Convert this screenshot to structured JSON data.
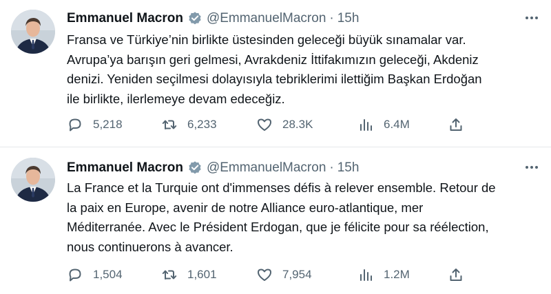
{
  "tweets": [
    {
      "author": {
        "name": "Emmanuel Macron",
        "handle": "@EmmanuelMacron",
        "verified": true
      },
      "separator": "·",
      "time": "15h",
      "text": "Fransa ve Türkiye’nin birlikte üstesinden geleceği büyük sınamalar var.\nAvrupa’ya barışın geri gelmesi, Avrakdeniz İttifakımızın geleceği, Akdeniz\ndenizi. Yeniden seçilmesi dolayısıyla tebriklerimi ilettiğim Başkan Erdoğan\nile birlikte, ilerlemeye devam edeceğiz.",
      "stats": {
        "replies": "5,218",
        "retweets": "6,233",
        "likes": "28.3K",
        "views": "6.4M"
      }
    },
    {
      "author": {
        "name": "Emmanuel Macron",
        "handle": "@EmmanuelMacron",
        "verified": true
      },
      "separator": "·",
      "time": "15h",
      "text": "La France et la Turquie ont d'immenses défis à relever ensemble. Retour de\nla paix en Europe, avenir de notre Alliance euro-atlantique, mer\nMéditerranée. Avec le Président Erdogan, que je félicite pour sa réélection,\nnous continuerons à avancer.",
      "stats": {
        "replies": "1,504",
        "retweets": "1,601",
        "likes": "7,954",
        "views": "1.2M"
      }
    }
  ],
  "colors": {
    "text": "#0f1419",
    "secondary": "#536471",
    "verified": "#829aab",
    "divider": "#e6e9eb"
  },
  "icons": [
    "reply-icon",
    "retweet-icon",
    "like-icon",
    "views-icon",
    "share-icon",
    "verified-badge-icon",
    "more-icon"
  ]
}
